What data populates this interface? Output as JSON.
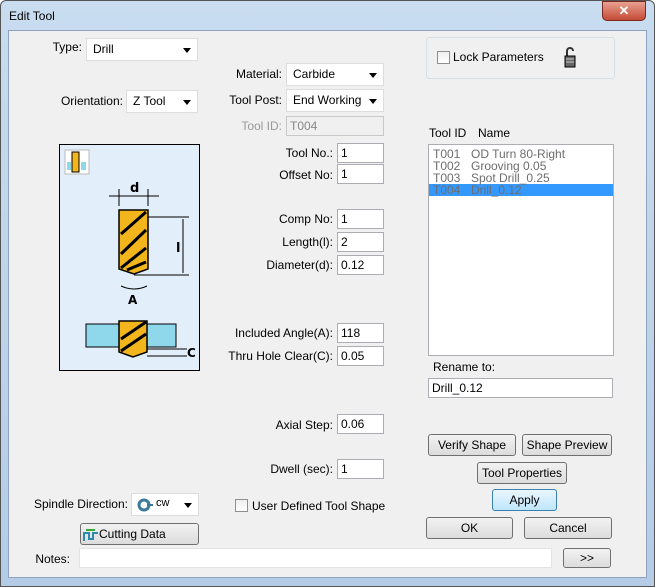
{
  "window": {
    "title": "Edit Tool",
    "close_icon": "close-icon"
  },
  "type": {
    "label": "Type:",
    "value": "Drill"
  },
  "orientation": {
    "label": "Orientation:",
    "value": "Z Tool"
  },
  "material": {
    "label": "Material:",
    "value": "Carbide"
  },
  "tool_post": {
    "label": "Tool Post:",
    "value": "End Working"
  },
  "tool_id": {
    "label": "Tool ID:",
    "value": "T004"
  },
  "lock": {
    "label": "Lock Parameters",
    "checked": false,
    "icon": "lock-open-icon"
  },
  "list": {
    "headers": [
      "Tool ID",
      "Name"
    ],
    "rows": [
      {
        "id": "T001",
        "name": "OD Turn 80-Right"
      },
      {
        "id": "T002",
        "name": "Grooving 0.05"
      },
      {
        "id": "T003",
        "name": "Spot Drill_0.25"
      },
      {
        "id": "T004",
        "name": "Drill_0.12",
        "selected": true
      }
    ]
  },
  "fields": {
    "tool_no": {
      "label": "Tool No.:",
      "value": "1"
    },
    "offset_no": {
      "label": "Offset No:",
      "value": "1"
    },
    "comp_no": {
      "label": "Comp No:",
      "value": "1"
    },
    "length": {
      "label": "Length(l):",
      "value": "2"
    },
    "diameter": {
      "label": "Diameter(d):",
      "value": "0.12"
    },
    "included_angle": {
      "label": "Included Angle(A):",
      "value": "118"
    },
    "thru_hole": {
      "label": "Thru Hole Clear(C):",
      "value": "0.05"
    },
    "axial_step": {
      "label": "Axial Step:",
      "value": "0.06"
    },
    "dwell": {
      "label": "Dwell (sec):",
      "value": "1"
    }
  },
  "diagram": {
    "d": "d",
    "l": "l",
    "A": "A",
    "C": "C"
  },
  "rename": {
    "label": "Rename to:",
    "value": "Drill_0.12"
  },
  "buttons": {
    "verify": "Verify Shape",
    "preview": "Shape Preview",
    "properties": "Tool Properties",
    "apply": "Apply",
    "ok": "OK",
    "cancel": "Cancel",
    "cutting": "Cutting Data",
    "more": ">>"
  },
  "spindle": {
    "label": "Spindle Direction:",
    "value": "cw"
  },
  "user_defined": {
    "label": "User Defined Tool Shape",
    "checked": false
  },
  "notes": {
    "label": "Notes:",
    "value": ""
  },
  "colors": {
    "selection": "#3399ff",
    "drill": "#f2b51c",
    "workpiece": "#8fd8ec",
    "diagram_bg": "#e2eefa"
  }
}
